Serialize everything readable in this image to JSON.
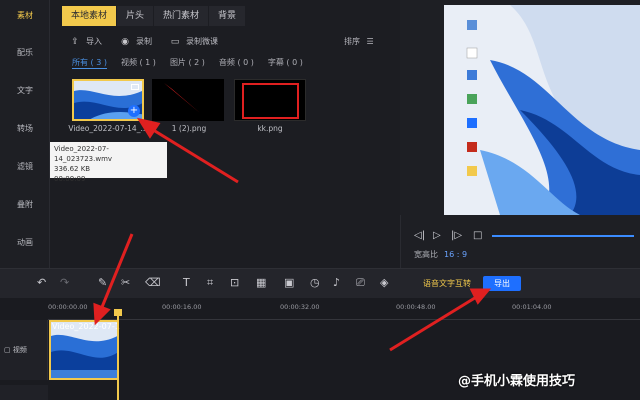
{
  "left_nav": {
    "items": [
      {
        "label": "素材"
      },
      {
        "label": "配乐"
      },
      {
        "label": "文字"
      },
      {
        "label": "转场"
      },
      {
        "label": "滤镜"
      },
      {
        "label": "叠附"
      },
      {
        "label": "动画"
      }
    ]
  },
  "library_tabs": [
    {
      "label": "本地素材"
    },
    {
      "label": "片头"
    },
    {
      "label": "热门素材"
    },
    {
      "label": "背景"
    }
  ],
  "toolbar": {
    "import": "导入",
    "record": "录制",
    "record_mic": "录制微课",
    "sort": "排序"
  },
  "filters": [
    {
      "label": "所有 ( 3 )"
    },
    {
      "label": "视频 ( 1 )"
    },
    {
      "label": "图片 ( 2 )"
    },
    {
      "label": "音频 ( 0 )"
    },
    {
      "label": "字幕 ( 0 )"
    }
  ],
  "media": [
    {
      "name": "Video_2022-07-14_..."
    },
    {
      "name": "1 (2).png"
    },
    {
      "name": "kk.png"
    }
  ],
  "tooltip": {
    "filename": "Video_2022-07-14_023723.wmv",
    "size": "336.62 KB",
    "duration": "00:00:09"
  },
  "preview": {
    "ratio_label": "宽高比",
    "ratio_value": "16 : 9"
  },
  "edit_toolbar": {
    "speech_to_text": "语音文字互转",
    "export": "导出"
  },
  "timeline": {
    "ticks": [
      "00:00:00.00",
      "00:00:16.00",
      "00:00:32.00",
      "00:00:48.00",
      "00:01:04.00"
    ],
    "video_track_label": "视频",
    "clip_label": "Video_2022-07-1"
  },
  "watermark": "@手机小霖使用技巧",
  "colors": {
    "accent": "#f2c94c",
    "export_button": "#1e6fff",
    "annotation_arrow": "#e02020"
  }
}
